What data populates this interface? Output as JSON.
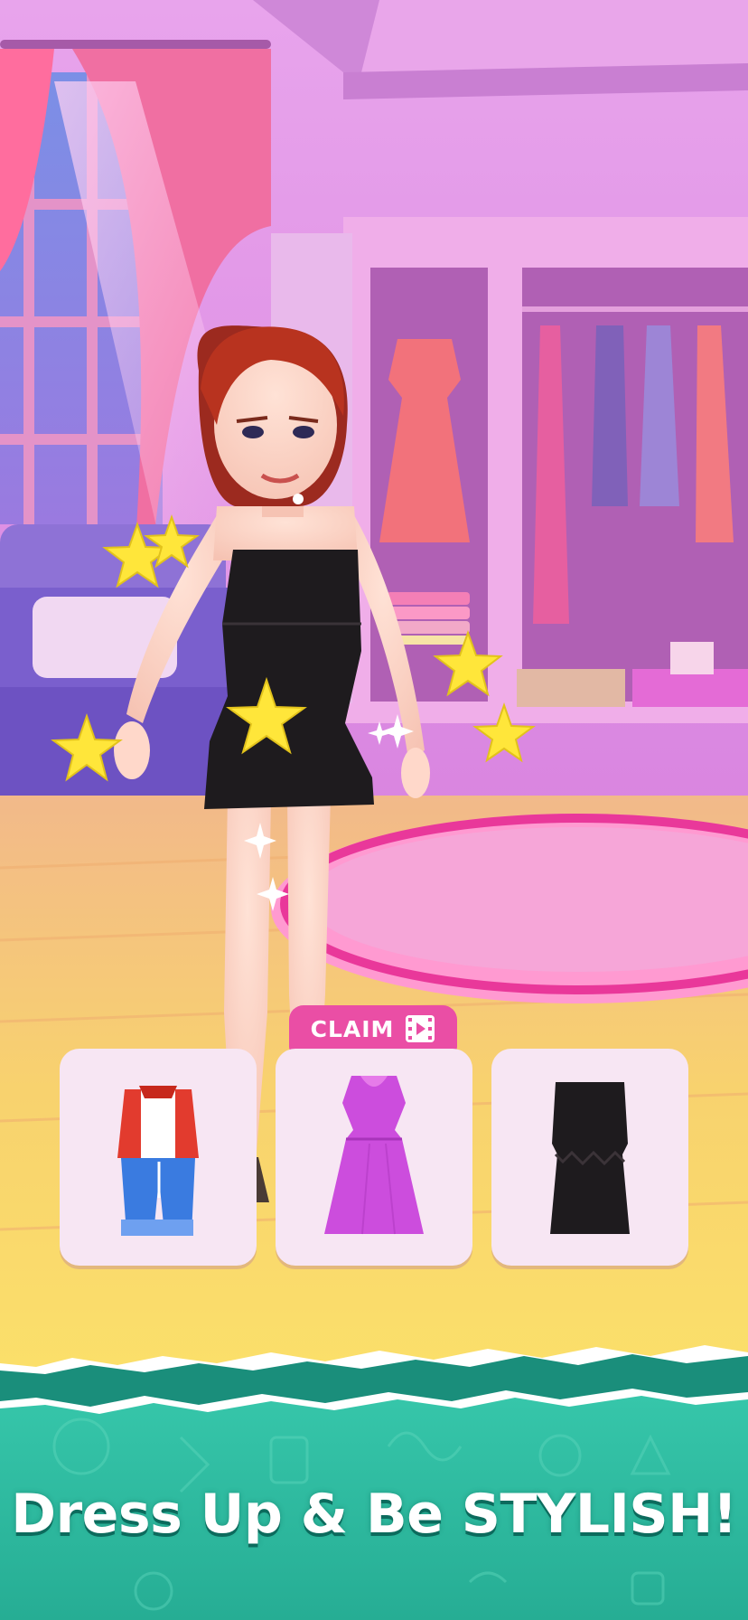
{
  "claim_button": {
    "label": "CLAIM",
    "icon": "video-ad-icon"
  },
  "outfits": [
    {
      "name": "casual-jacket-jeans-outfit"
    },
    {
      "name": "purple-dress-outfit"
    },
    {
      "name": "black-strapless-dress-outfit"
    }
  ],
  "banner": {
    "tagline": "Dress Up & Be STYLISH!"
  },
  "colors": {
    "room_wall": "#e79be7",
    "floor": "#f5c86a",
    "banner_teal": "#2bb89e",
    "claim_pink": "#ea4ea5",
    "card_bg": "#f7e6f3"
  }
}
